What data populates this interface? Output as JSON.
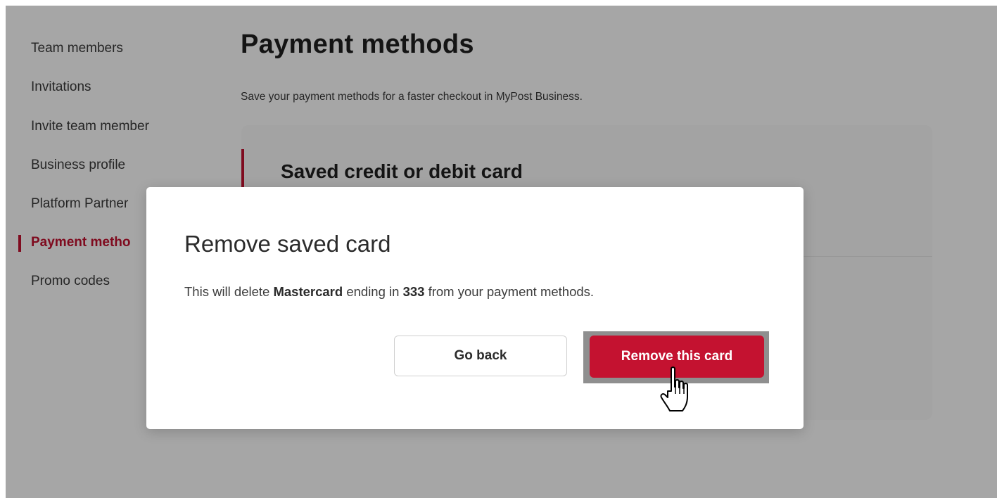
{
  "sidebar": {
    "items": [
      {
        "label": "Team members"
      },
      {
        "label": "Invitations"
      },
      {
        "label": "Invite team member"
      },
      {
        "label": "Business profile"
      },
      {
        "label": "Platform Partner"
      },
      {
        "label": "Payment metho"
      },
      {
        "label": "Promo codes"
      }
    ]
  },
  "main": {
    "title": "Payment methods",
    "subtitle": "Save your payment methods for a faster checkout in MyPost Business.",
    "card_section": {
      "heading": "Saved credit or debit card",
      "link_fragment": "d"
    }
  },
  "modal": {
    "title": "Remove saved card",
    "body_prefix": "This will delete ",
    "card_brand": "Mastercard",
    "body_middle": " ending in ",
    "card_last_digits": "333",
    "body_suffix": " from your payment methods.",
    "back_label": "Go back",
    "remove_label": "Remove this card"
  },
  "cursor": {
    "icon": "hand-pointer-icon"
  },
  "colors": {
    "accent": "#c41230",
    "overlay": "rgba(0,0,0,0.35)"
  }
}
